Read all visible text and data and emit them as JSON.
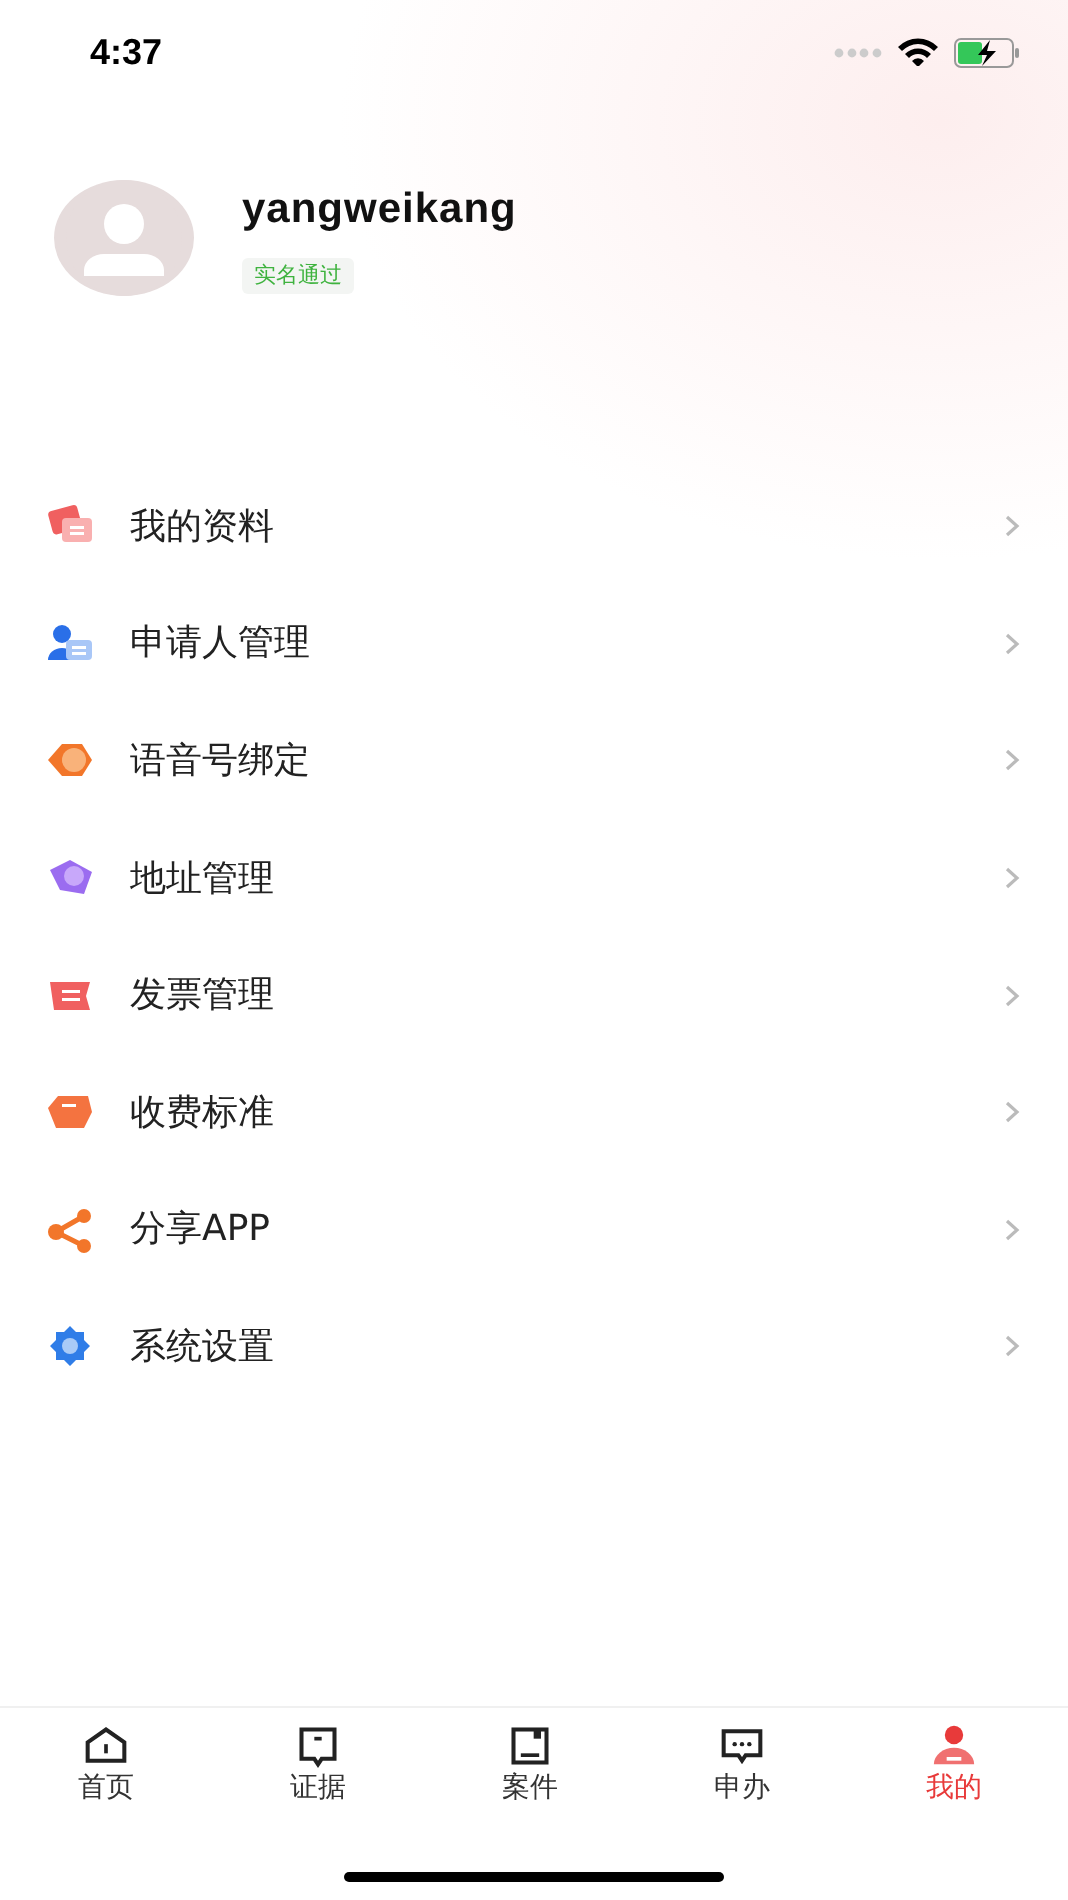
{
  "status_bar": {
    "time": "4:37"
  },
  "profile": {
    "username": "yangweikang",
    "badge": "实名通过"
  },
  "menu": [
    {
      "label": "我的资料",
      "kind": "card"
    },
    {
      "label": "申请人管理",
      "kind": "person"
    },
    {
      "label": "语音号绑定",
      "kind": "tag"
    },
    {
      "label": "地址管理",
      "kind": "pin"
    },
    {
      "label": "发票管理",
      "kind": "ticket"
    },
    {
      "label": "收费标准",
      "kind": "wallet"
    },
    {
      "label": "分享APP",
      "kind": "share"
    },
    {
      "label": "系统设置",
      "kind": "gear"
    }
  ],
  "tab_bar": [
    {
      "label": "首页",
      "kind": "home",
      "selected": false
    },
    {
      "label": "证据",
      "kind": "flag",
      "selected": false
    },
    {
      "label": "案件",
      "kind": "box",
      "selected": false
    },
    {
      "label": "申办",
      "kind": "chat",
      "selected": false
    },
    {
      "label": "我的",
      "kind": "me",
      "selected": true
    }
  ]
}
